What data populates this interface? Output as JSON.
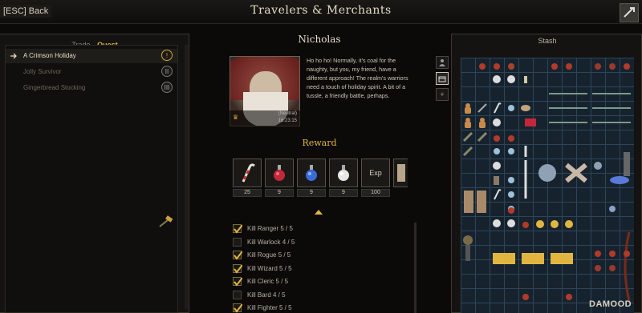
{
  "header": {
    "back_label": "[ESC] Back",
    "title": "Travelers & Merchants"
  },
  "left_panel": {
    "tabs": [
      {
        "label": "Trade",
        "active": false
      },
      {
        "label": "Quest",
        "active": true
      }
    ],
    "quests": [
      {
        "label": "A Crimson Holiday",
        "active": true,
        "badge": "!"
      },
      {
        "label": "Jolly Survivor",
        "active": false,
        "badge": "II"
      },
      {
        "label": "Gingerbread Stocking",
        "active": false,
        "badge": "III"
      }
    ]
  },
  "npc": {
    "name": "Nicholas",
    "faction": "(Neutral)",
    "timer": "16:23:15",
    "dialog": "Ho ho ho! Normally, it's coal for the naughty, but you, my friend, have a different approach! The realm's warriors need a touch of holiday spirit. A bit of a tussle, a friendly battle, perhaps."
  },
  "reward": {
    "title": "Reward",
    "items": [
      {
        "icon": "candy-cane-icon",
        "count": "25"
      },
      {
        "icon": "red-potion-icon",
        "count": "9"
      },
      {
        "icon": "blue-potion-icon",
        "count": "9"
      },
      {
        "icon": "white-potion-icon",
        "count": "9"
      },
      {
        "icon": "exp-icon",
        "label": "Exp",
        "count": "100"
      }
    ]
  },
  "objectives": [
    {
      "label": "Kill Ranger 5 / 5",
      "done": true
    },
    {
      "label": "Kill Warlock 4 / 5",
      "done": false
    },
    {
      "label": "Kill Rogue 5 / 5",
      "done": true
    },
    {
      "label": "Kill Wizard 5 / 5",
      "done": true
    },
    {
      "label": "Kill Cleric 5 / 5",
      "done": true
    },
    {
      "label": "Kill Bard 4 / 5",
      "done": false
    },
    {
      "label": "Kill Fighter 5 / 5",
      "done": true
    }
  ],
  "stash": {
    "title": "Stash",
    "side_tools": [
      "person-icon",
      "chest-icon",
      "plus-icon"
    ]
  },
  "watermark": "DAMOOD",
  "colors": {
    "accent_gold": "#e0b640",
    "stash_grid": "#16232f",
    "panel_bg": "#141311"
  }
}
